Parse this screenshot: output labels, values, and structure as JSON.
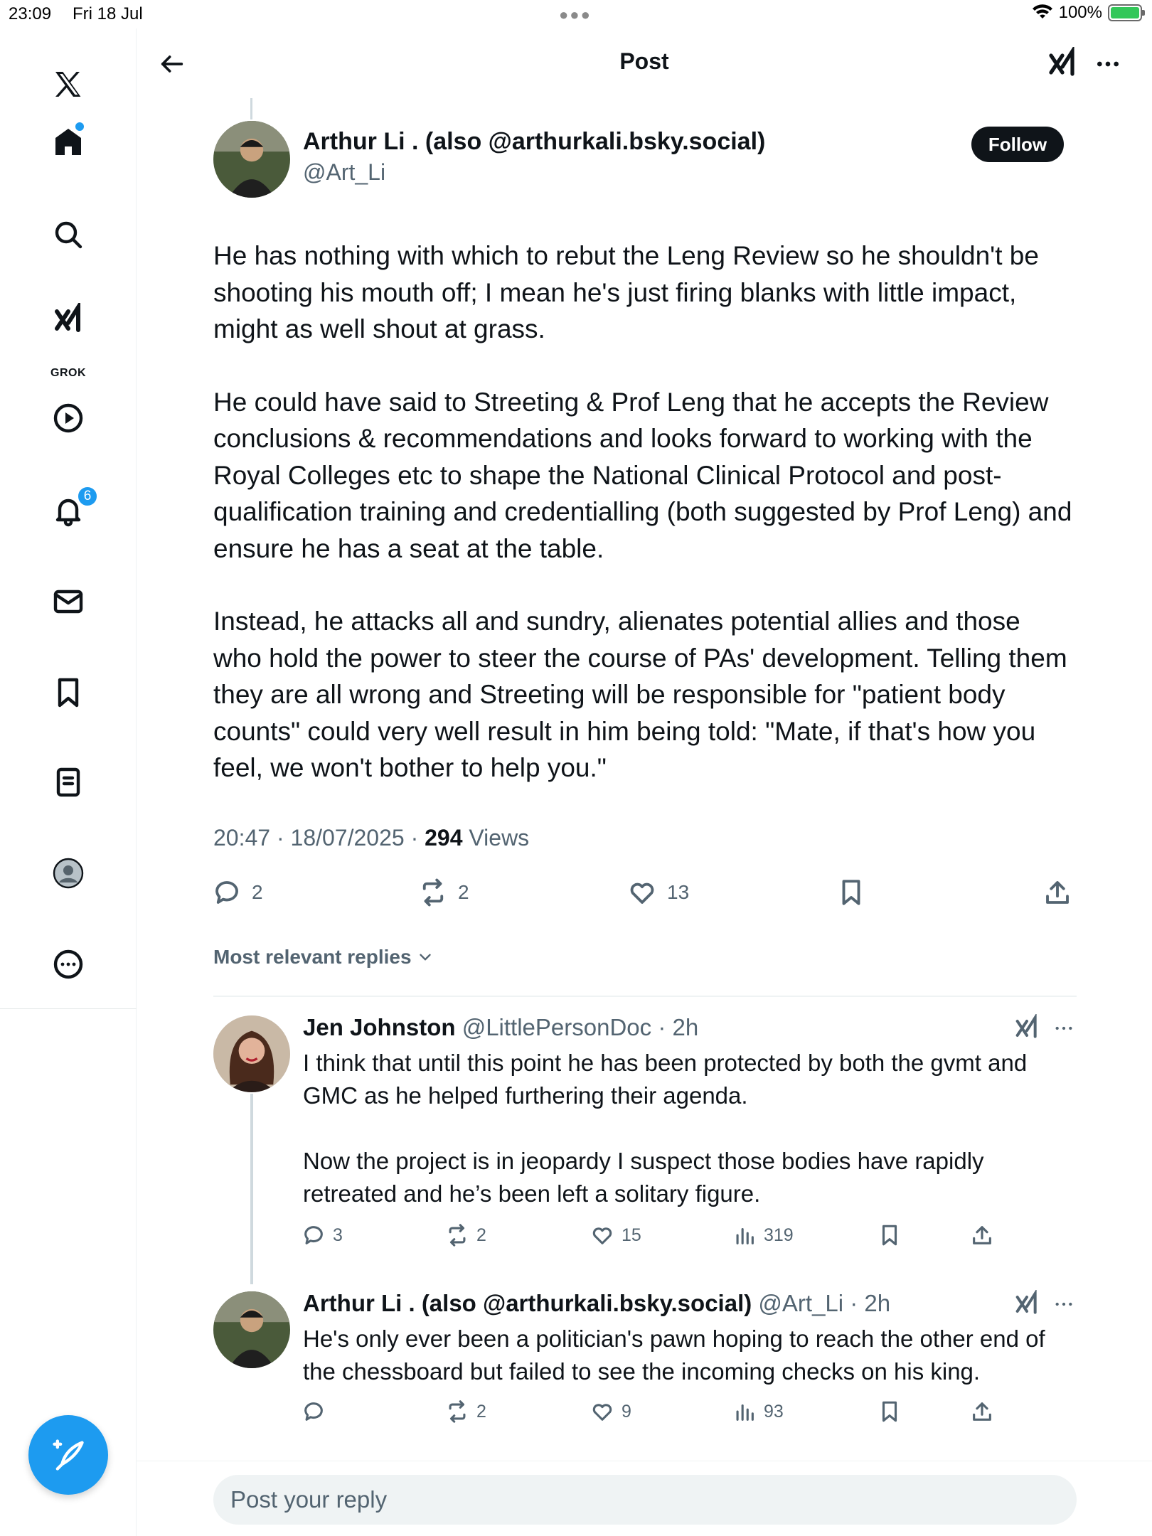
{
  "status_bar": {
    "time": "23:09",
    "date": "Fri 18 Jul",
    "battery": "100%"
  },
  "sidebar": {
    "grok_label": "GROK",
    "notifications_count": "6"
  },
  "header": {
    "title": "Post"
  },
  "post": {
    "author_name": "Arthur Li . (also @arthurkali.bsky.social)",
    "author_handle": "@Art_Li",
    "follow_label": "Follow",
    "paragraphs": [
      "He has nothing with which to rebut the Leng Review so he shouldn't be shooting his mouth off; I mean he's just firing blanks with little impact, might as well shout at grass.",
      "He could have said to Streeting & Prof Leng that he accepts the Review conclusions & recommendations and looks forward to working with the Royal Colleges etc to shape the National Clinical Protocol and post-qualification training and credentialling (both suggested by Prof Leng) and ensure he has a seat at the table.",
      "Instead, he attacks all and sundry, alienates potential allies and those who hold the power to steer the course of  PAs' development. Telling them they are all wrong and Streeting will be responsible for \"patient body counts\" could very well result in him being told: \"Mate, if that's how you feel, we won't bother to help you.\""
    ],
    "timestamp": "20:47 · 18/07/2025 · ",
    "views_count": "294",
    "views_label": " Views",
    "replies": "2",
    "reposts": "2",
    "likes": "13"
  },
  "replies_filter": "Most relevant replies",
  "replies": [
    {
      "name": "Jen Johnston",
      "handle": " @LittlePersonDoc · 2h",
      "paragraphs": [
        "I think that until this point he has been protected by both the gvmt and GMC as he helped furthering their agenda.",
        "Now the project is in jeopardy I suspect those bodies have rapidly retreated and he’s been left a solitary figure."
      ],
      "replies": "3",
      "reposts": "2",
      "likes": "15",
      "views": "319"
    },
    {
      "name": "Arthur Li . (also @arthurkali.bsky.social)",
      "handle": " @Art_Li · 2h",
      "paragraphs": [
        "He's only ever been a politician's pawn hoping to reach the other end of the chessboard but failed to see the incoming checks on his king."
      ],
      "replies": "",
      "reposts": "2",
      "likes": "9",
      "views": "93"
    }
  ],
  "composer": {
    "placeholder": "Post your reply"
  },
  "colors": {
    "accent": "#1d9bf0",
    "text": "#0f1419",
    "secondary": "#536471"
  }
}
